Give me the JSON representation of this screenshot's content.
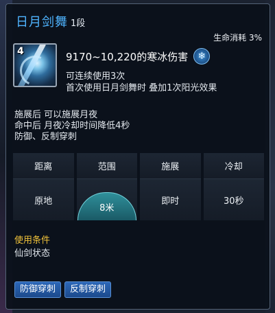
{
  "skill": {
    "name": "日月剑舞",
    "level": "1段",
    "cost": "生命消耗 3%",
    "icon_badge": "4",
    "damage": "9170~10,220的寒冰伤害",
    "damage_type_icon": "frost-snowflake-icon",
    "effects": [
      "可连续使用3次",
      "首次使用日月剑舞时 叠加1次阳光效果"
    ],
    "descriptions": [
      "施展后 可以施展月夜",
      "命中后 月夜冷却时间降低4秒",
      "防御、反制穿刺"
    ]
  },
  "stats": {
    "headers": [
      "距离",
      "范围",
      "施展",
      "冷却"
    ],
    "values": [
      "原地",
      "8米",
      "即时",
      "30秒"
    ]
  },
  "condition": {
    "title": "使用条件",
    "value": "仙剑状态"
  },
  "tags": [
    "防御穿刺",
    "反制穿刺"
  ],
  "colors": {
    "title": "#4fb4ff",
    "condition_title": "#f0c23a",
    "tag_bg": "#2c67b8",
    "range_dome": "#2f8f9a"
  }
}
